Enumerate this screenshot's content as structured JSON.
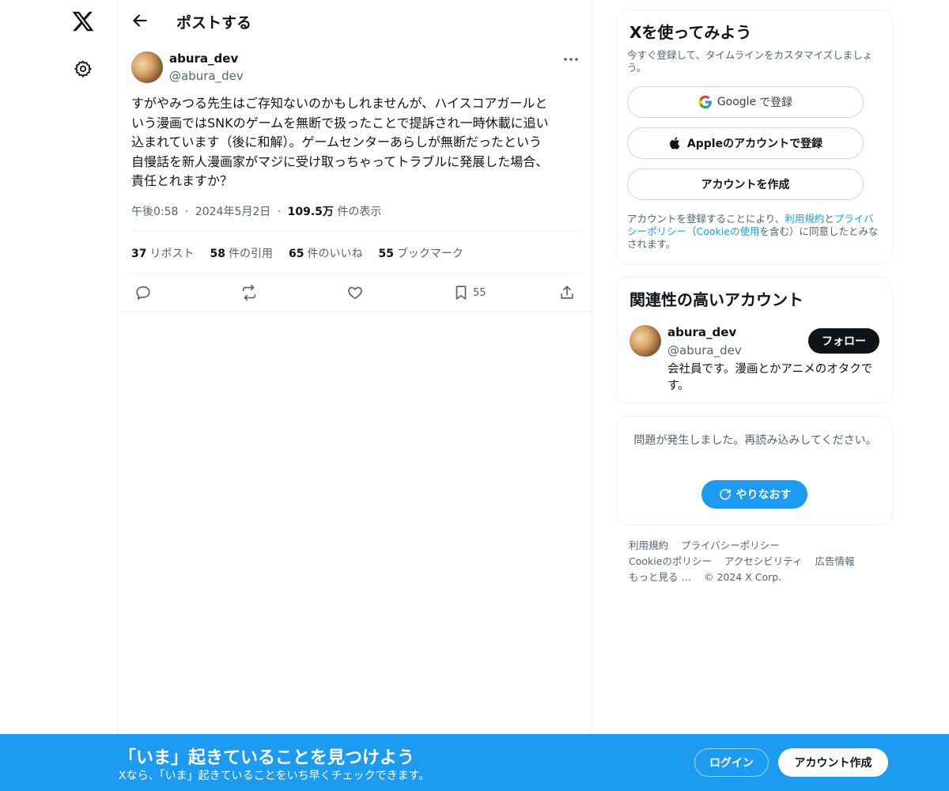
{
  "nav": {
    "x_logo_icon": "x-logo-icon",
    "settings_icon": "gear-icon"
  },
  "header": {
    "title": "ポストする",
    "back_icon": "arrow-left-icon"
  },
  "post": {
    "author_name": "abura_dev",
    "author_handle": "@abura_dev",
    "text": "すがやみつる先生はご存知ないのかもしれませんが、ハイスコアガールと\nいう漫画ではSNKのゲームを無断で扱ったことで提訴され一時休載に追い\n込まれています（後に和解）。ゲームセンターあらしが無断だったという\n自慢話を新人漫画家がマジに受け取っちゃってトラブルに発展した場合、\n責任とれますか？",
    "time": "午後0:58",
    "date": "2024年5月2日",
    "views_value": "109.5万",
    "views_label": "件の表示",
    "separator": "·",
    "stats": {
      "reposts_value": "37",
      "reposts_label": "リポスト",
      "quotes_value": "58",
      "quotes_label": "件の引用",
      "likes_value": "65",
      "likes_label": "件のいいね",
      "bookmarks_value": "55",
      "bookmarks_label": "ブックマーク"
    },
    "actions": {
      "bookmark_count": "55"
    }
  },
  "signup_card": {
    "title": "Xを使ってみよう",
    "subtitle": "今すぐ登録して、タイムラインをカスタマイズしましょう。",
    "google_brand": "Google",
    "google_label": "で登録",
    "apple_label": "Appleのアカウントで登録",
    "create_label": "アカウントを作成",
    "terms_pre": "アカウントを登録することにより、",
    "terms_link": "利用規約",
    "terms_and": "と",
    "privacy_link": "プライバシーポリシー",
    "terms_paren_open": "（",
    "cookie_link": "Cookieの使用",
    "terms_post": "を含む）に同意したとみなされます。"
  },
  "related_card": {
    "title": "関連性の高いアカウント",
    "name": "abura_dev",
    "handle": "@abura_dev",
    "bio": "会社員です。漫画とかアニメのオタクです。",
    "follow_label": "フォロー"
  },
  "error_card": {
    "message": "問題が発生しました。再読み込みしてください。",
    "retry_label": "やりなおす"
  },
  "footer": {
    "terms": "利用規約",
    "privacy": "プライバシーポリシー",
    "cookie": "Cookieのポリシー",
    "accessibility": "アクセシビリティ",
    "ads": "広告情報",
    "more": "もっと見る …",
    "copyright": "© 2024 X Corp."
  },
  "banner": {
    "title": "「いま」起きていることを見つけよう",
    "subtitle": "Xなら、「いま」起きていることをいち早くチェックできます。",
    "login_label": "ログイン",
    "signup_label": "アカウント作成"
  },
  "colors": {
    "accent": "#1d9bf0",
    "text": "#0f1419",
    "muted": "#536471",
    "border": "#eff3f4"
  }
}
